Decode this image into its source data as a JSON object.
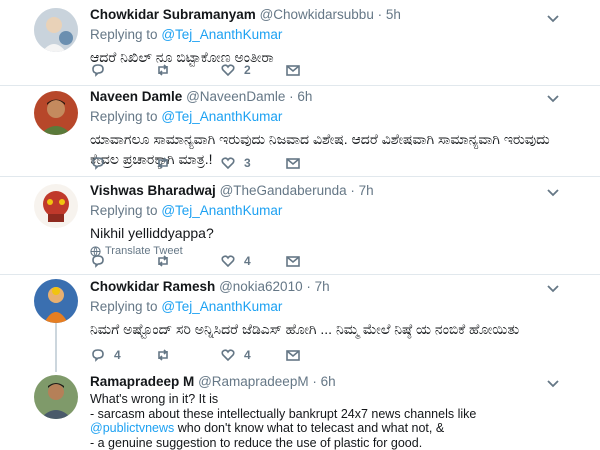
{
  "colors": {
    "link": "#1da1f2",
    "muted": "#657786",
    "text": "#14171a",
    "divider": "#e1e8ed"
  },
  "tweets": [
    {
      "name": "Chowkidar Subramanyam",
      "handle": "@Chowkidarsubbu",
      "time": "· 5h",
      "reply_prefix": "Replying to",
      "reply_to": "@Tej_AnanthKumar",
      "text": "ಆದರೆ ನಿಖಿಲ್ ನೂ ಬಿಟ್ಟಾಕೋಣ ಅಂತೀರಾ",
      "likes": "2"
    },
    {
      "name": "Naveen Damle",
      "handle": "@NaveenDamle",
      "time": "· 6h",
      "reply_prefix": "Replying to",
      "reply_to": "@Tej_AnanthKumar",
      "text": "ಯಾವಾಗಲೂ ಸಾಮಾನ್ಯವಾಗಿ ಇರುವುದು ನಿಜವಾದ ವಿಶೇಷ. ಆದರೆ ವಿಶೇಷವಾಗಿ ಸಾಮಾನ್ಯವಾಗಿ ಇರುವುದು ಕೇವಲ ಪ್ರಚಾರಕ್ಕಾಗಿ ಮಾತ್ರ.!",
      "likes": "3"
    },
    {
      "name": "Vishwas Bharadwaj",
      "handle": "@TheGandaberunda",
      "time": "· 7h",
      "reply_prefix": "Replying to",
      "reply_to": "@Tej_AnanthKumar",
      "text": "Nikhil yelliddyappa?",
      "translate": "Translate Tweet",
      "likes": "4"
    },
    {
      "name": "Chowkidar Ramesh",
      "handle": "@nokia62010",
      "time": "· 7h",
      "reply_prefix": "Replying to",
      "reply_to": "@Tej_AnanthKumar",
      "text": "ನಿಮಗೆ ಅಷ್ಟೊಂದ್ ಸರಿ ಅನ್ನಿಸಿದರೆ ಜೆಡಿಎಸ್ ಹೋಗಿ ... ನಿಮ್ಮ ಮೇಲೆ ನಿಷ್ಠೆ ಯ ನಂಬಿಕೆ ಹೋಯಿತು",
      "replies": "4",
      "likes": "4"
    },
    {
      "name": "Ramapradeep M",
      "handle": "@RamapradeepM",
      "time": "· 6h",
      "line1": "What's wrong in it? It is",
      "line2": "- sarcasm about these intellectually bankrupt 24x7 news channels like",
      "line3_link": "@publictvnews",
      "line3_rest": " who don't know what to telecast and what not, &",
      "line4": "- a genuine suggestion to reduce the use of plastic for good."
    }
  ]
}
